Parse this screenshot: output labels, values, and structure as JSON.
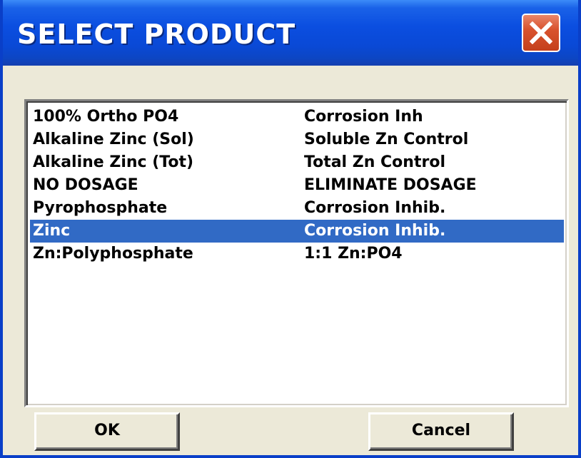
{
  "window": {
    "title": "SELECT PRODUCT"
  },
  "title_bar": {
    "close_icon": "close-x-icon",
    "accent_color": "#0a49d6",
    "close_color": "#d9532e"
  },
  "product_list": {
    "selected_color": "#316ac5",
    "items": [
      {
        "name": "100% Ortho PO4",
        "description": "Corrosion Inh",
        "selected": false
      },
      {
        "name": "Alkaline Zinc (Sol)",
        "description": "Soluble Zn Control",
        "selected": false
      },
      {
        "name": "Alkaline Zinc (Tot)",
        "description": "Total Zn Control",
        "selected": false
      },
      {
        "name": "NO DOSAGE",
        "description": "ELIMINATE DOSAGE",
        "selected": false
      },
      {
        "name": "Pyrophosphate",
        "description": "Corrosion Inhib.",
        "selected": false
      },
      {
        "name": "Zinc",
        "description": "Corrosion Inhib.",
        "selected": true
      },
      {
        "name": "Zn:Polyphosphate",
        "description": "1:1 Zn:PO4",
        "selected": false
      }
    ]
  },
  "buttons": {
    "ok_label": "OK",
    "cancel_label": "Cancel"
  }
}
